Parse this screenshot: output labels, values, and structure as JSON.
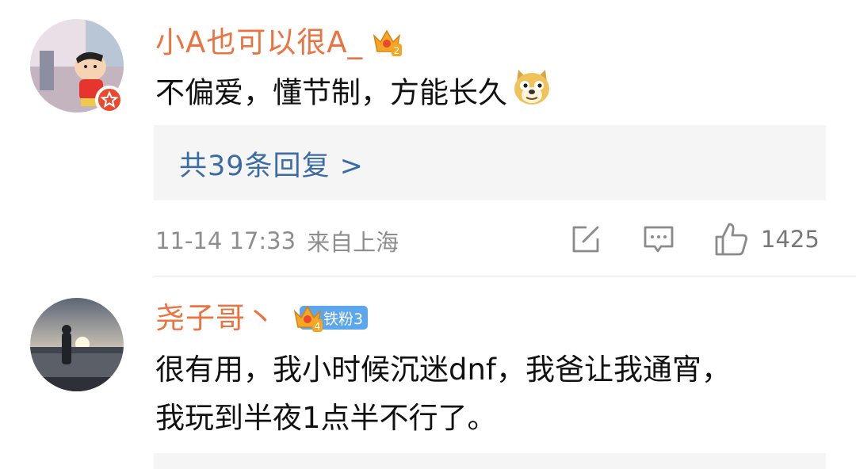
{
  "comments": [
    {
      "username": "小A也可以很A_",
      "crown_level": "2",
      "text": "不偏爱，懂节制，方能长久",
      "emoji": "doge-emoji",
      "replies_label": "共39条回复 >",
      "timestamp": "11-14 17:33",
      "location": "来自上海",
      "likes": "1425"
    },
    {
      "username": "尧子哥丶",
      "crown_level": "4",
      "fan_badge": "铁粉3",
      "text_line1": "很有用，我小时候沉迷dnf，我爸让我通宵，",
      "text_line2": "我玩到半夜1点半不行了。"
    }
  ],
  "colors": {
    "username": "#eb7340",
    "link": "#3a6ba5",
    "meta": "#8d8d8d",
    "fan_badge": "#5ba6ec",
    "vip_badge": "#e8492f"
  }
}
